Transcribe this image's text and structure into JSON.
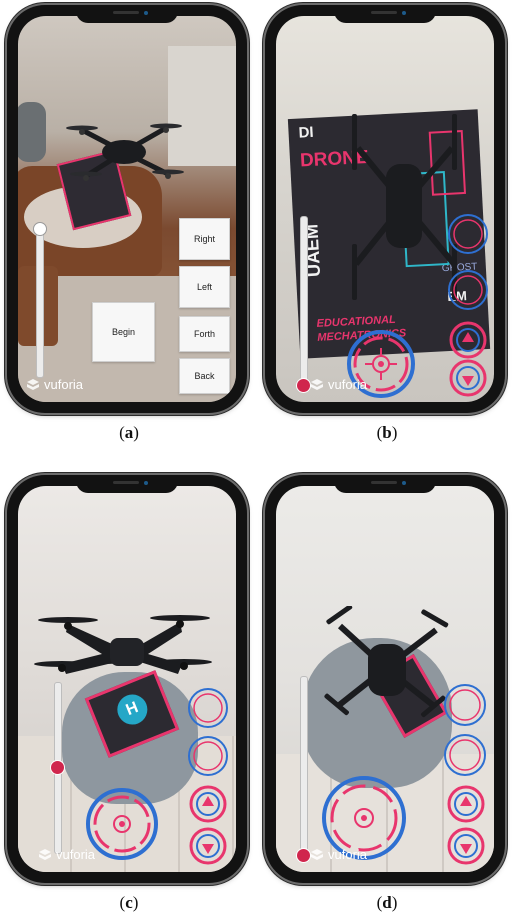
{
  "panel_a": {
    "caption_open": "(",
    "caption_letter": "a",
    "caption_close": ")",
    "buttons": {
      "right": "Right",
      "left": "Left",
      "forth": "Forth",
      "back": "Back",
      "begin": "Begin"
    },
    "brand": "vuforia",
    "slider_level": 0.95
  },
  "panel_b": {
    "caption_open": "(",
    "caption_letter": "b",
    "caption_close": ")",
    "brand": "vuforia",
    "slider_level": 0.0,
    "poster": {
      "line1": "DI",
      "line2": "DRONE",
      "side": "UAEM",
      "bottom1": "EDUCATIONAL",
      "bottom2": "MECHATRONICS",
      "right1": "EM",
      "right2": "GHOST"
    }
  },
  "panel_c": {
    "caption_open": "(",
    "caption_letter": "c",
    "caption_close": ")",
    "brand": "vuforia",
    "slider_level": 0.5,
    "pad_letter": "H"
  },
  "panel_d": {
    "caption_open": "(",
    "caption_letter": "d",
    "caption_close": ")",
    "brand": "vuforia",
    "slider_level": 0.0
  },
  "colors": {
    "hud_pink": "#e8356d",
    "hud_blue": "#2e6fd1",
    "knob_pink": "#d0264d",
    "drone_body": "#1b1c1f",
    "phone_frame": "#121212"
  },
  "icons": [
    "joystick-icon",
    "drone-icon",
    "vuforia-logo-icon",
    "up-arrow-icon",
    "down-arrow-icon",
    "rotate-icon"
  ]
}
